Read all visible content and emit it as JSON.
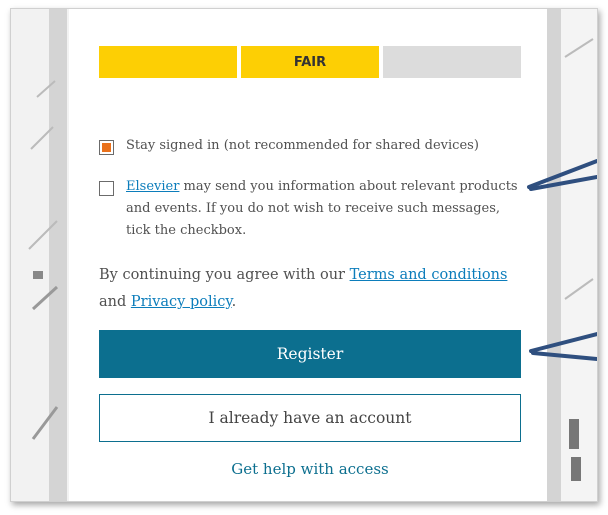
{
  "password_strength": {
    "label": "FAIR",
    "level": 0.67,
    "colors": {
      "filled": "#fdcf04",
      "empty": "#dcdcdc"
    }
  },
  "stay_signed_in": {
    "checked": true,
    "label": "Stay signed in (not recommended for shared devices)"
  },
  "marketing_opt_out": {
    "checked": false,
    "link_text": "Elsevier",
    "text": " may send you information about relevant products and events. If you do not wish to receive such messages, tick the checkbox."
  },
  "consent": {
    "prefix": "By continuing you agree with our ",
    "terms_link": "Terms and conditions",
    "middle": " and ",
    "privacy_link": "Privacy policy",
    "suffix": "."
  },
  "buttons": {
    "register": "Register",
    "existing_account": "I already have an account"
  },
  "help_link": "Get help with access",
  "colors": {
    "primary": "#0c6f8f",
    "link": "#0c7dbb",
    "checkbox_accent": "#e9711c",
    "annotation_arrow": "#2f4f7f"
  },
  "annotations": {
    "arrows": 2,
    "arrow_icon": "annotation-arrow-icon"
  }
}
